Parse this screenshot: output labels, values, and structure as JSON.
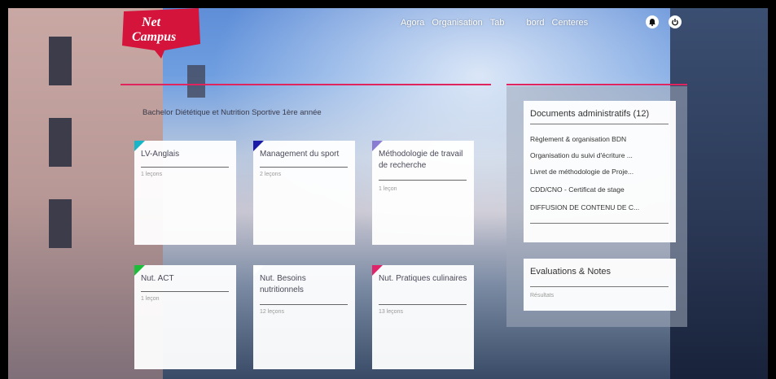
{
  "logo": {
    "line1": "Net",
    "line2": "Campus",
    "color": "#d4143a"
  },
  "nav": {
    "items": [
      "Agora",
      "Organisation",
      "Tab",
      "bord",
      "Centeres"
    ]
  },
  "course": {
    "title": "Bachelor Diététique et Nutrition Sportive 1ère année"
  },
  "cards": [
    {
      "title": "LV-Anglais",
      "sub": "1 leçons",
      "color": "#16b6c8"
    },
    {
      "title": "Management du sport",
      "sub": "2 leçons",
      "color": "#1a1aa8"
    },
    {
      "title": "Méthodologie de travail de recherche",
      "sub": "1 leçon",
      "color": "#8a7cd2"
    },
    {
      "title": "Nut. ACT",
      "sub": "1 leçon",
      "color": "#1cbd3a"
    },
    {
      "title": "Nut. Besoins nutritionnels",
      "sub": "12 leçons",
      "color": "#ffffff"
    },
    {
      "title": "Nut. Pratiques culinaires",
      "sub": "13 leçons",
      "color": "#e0246a"
    }
  ],
  "documents": {
    "header": "Documents administratifs (12)",
    "items": [
      "Règlement & organisation BDN",
      "Organisation du suivi d'écriture ...",
      "Livret de méthodologie de Proje...",
      "CDD/CNO - Certificat de stage",
      "DIFFUSION DE CONTENU DE C..."
    ]
  },
  "evaluations": {
    "header": "Evaluations & Notes",
    "sub": "Résultats"
  }
}
